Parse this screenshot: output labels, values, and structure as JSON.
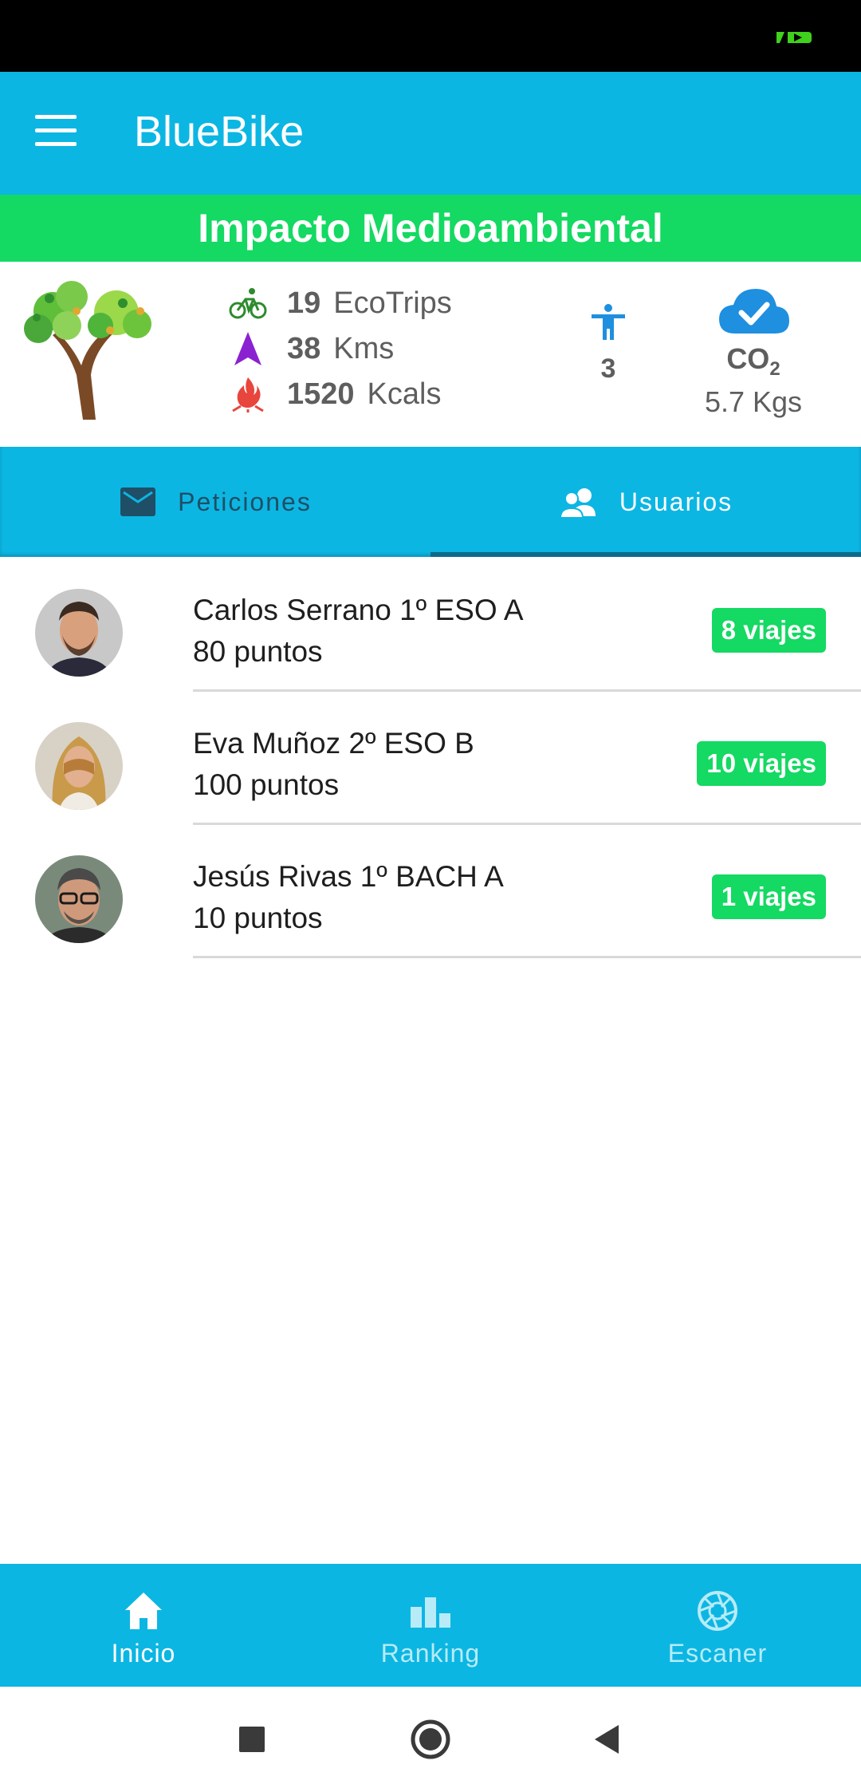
{
  "app": {
    "title": "BlueBike"
  },
  "banner": {
    "title": "Impacto Medioambiental"
  },
  "stats": {
    "ecotrips": {
      "value": "19",
      "unit": "EcoTrips"
    },
    "distance": {
      "value": "38",
      "unit": "Kms"
    },
    "calories": {
      "value": "1520",
      "unit": "Kcals"
    },
    "users": "3",
    "co2": {
      "label": "CO",
      "subscript": "2",
      "value": "5.7 Kgs"
    }
  },
  "tabs": [
    {
      "label": "Peticiones",
      "icon": "mail-icon",
      "active": false
    },
    {
      "label": "Usuarios",
      "icon": "users-icon",
      "active": true
    }
  ],
  "users": [
    {
      "name": "Carlos Serrano 1º ESO A",
      "points": "80 puntos",
      "trips": "8 viajes"
    },
    {
      "name": "Eva Muñoz 2º ESO B",
      "points": "100 puntos",
      "trips": "10 viajes"
    },
    {
      "name": "Jesús Rivas 1º BACH A",
      "points": "10 puntos",
      "trips": "1 viajes"
    }
  ],
  "bottom_nav": [
    {
      "label": "Inicio",
      "icon": "home-icon",
      "active": true
    },
    {
      "label": "Ranking",
      "icon": "ranking-icon",
      "active": false
    },
    {
      "label": "Escaner",
      "icon": "camera-shutter-icon",
      "active": false
    }
  ],
  "colors": {
    "primary": "#0cb6e3",
    "green": "#14d962",
    "stat_text": "#5e5e5e"
  }
}
